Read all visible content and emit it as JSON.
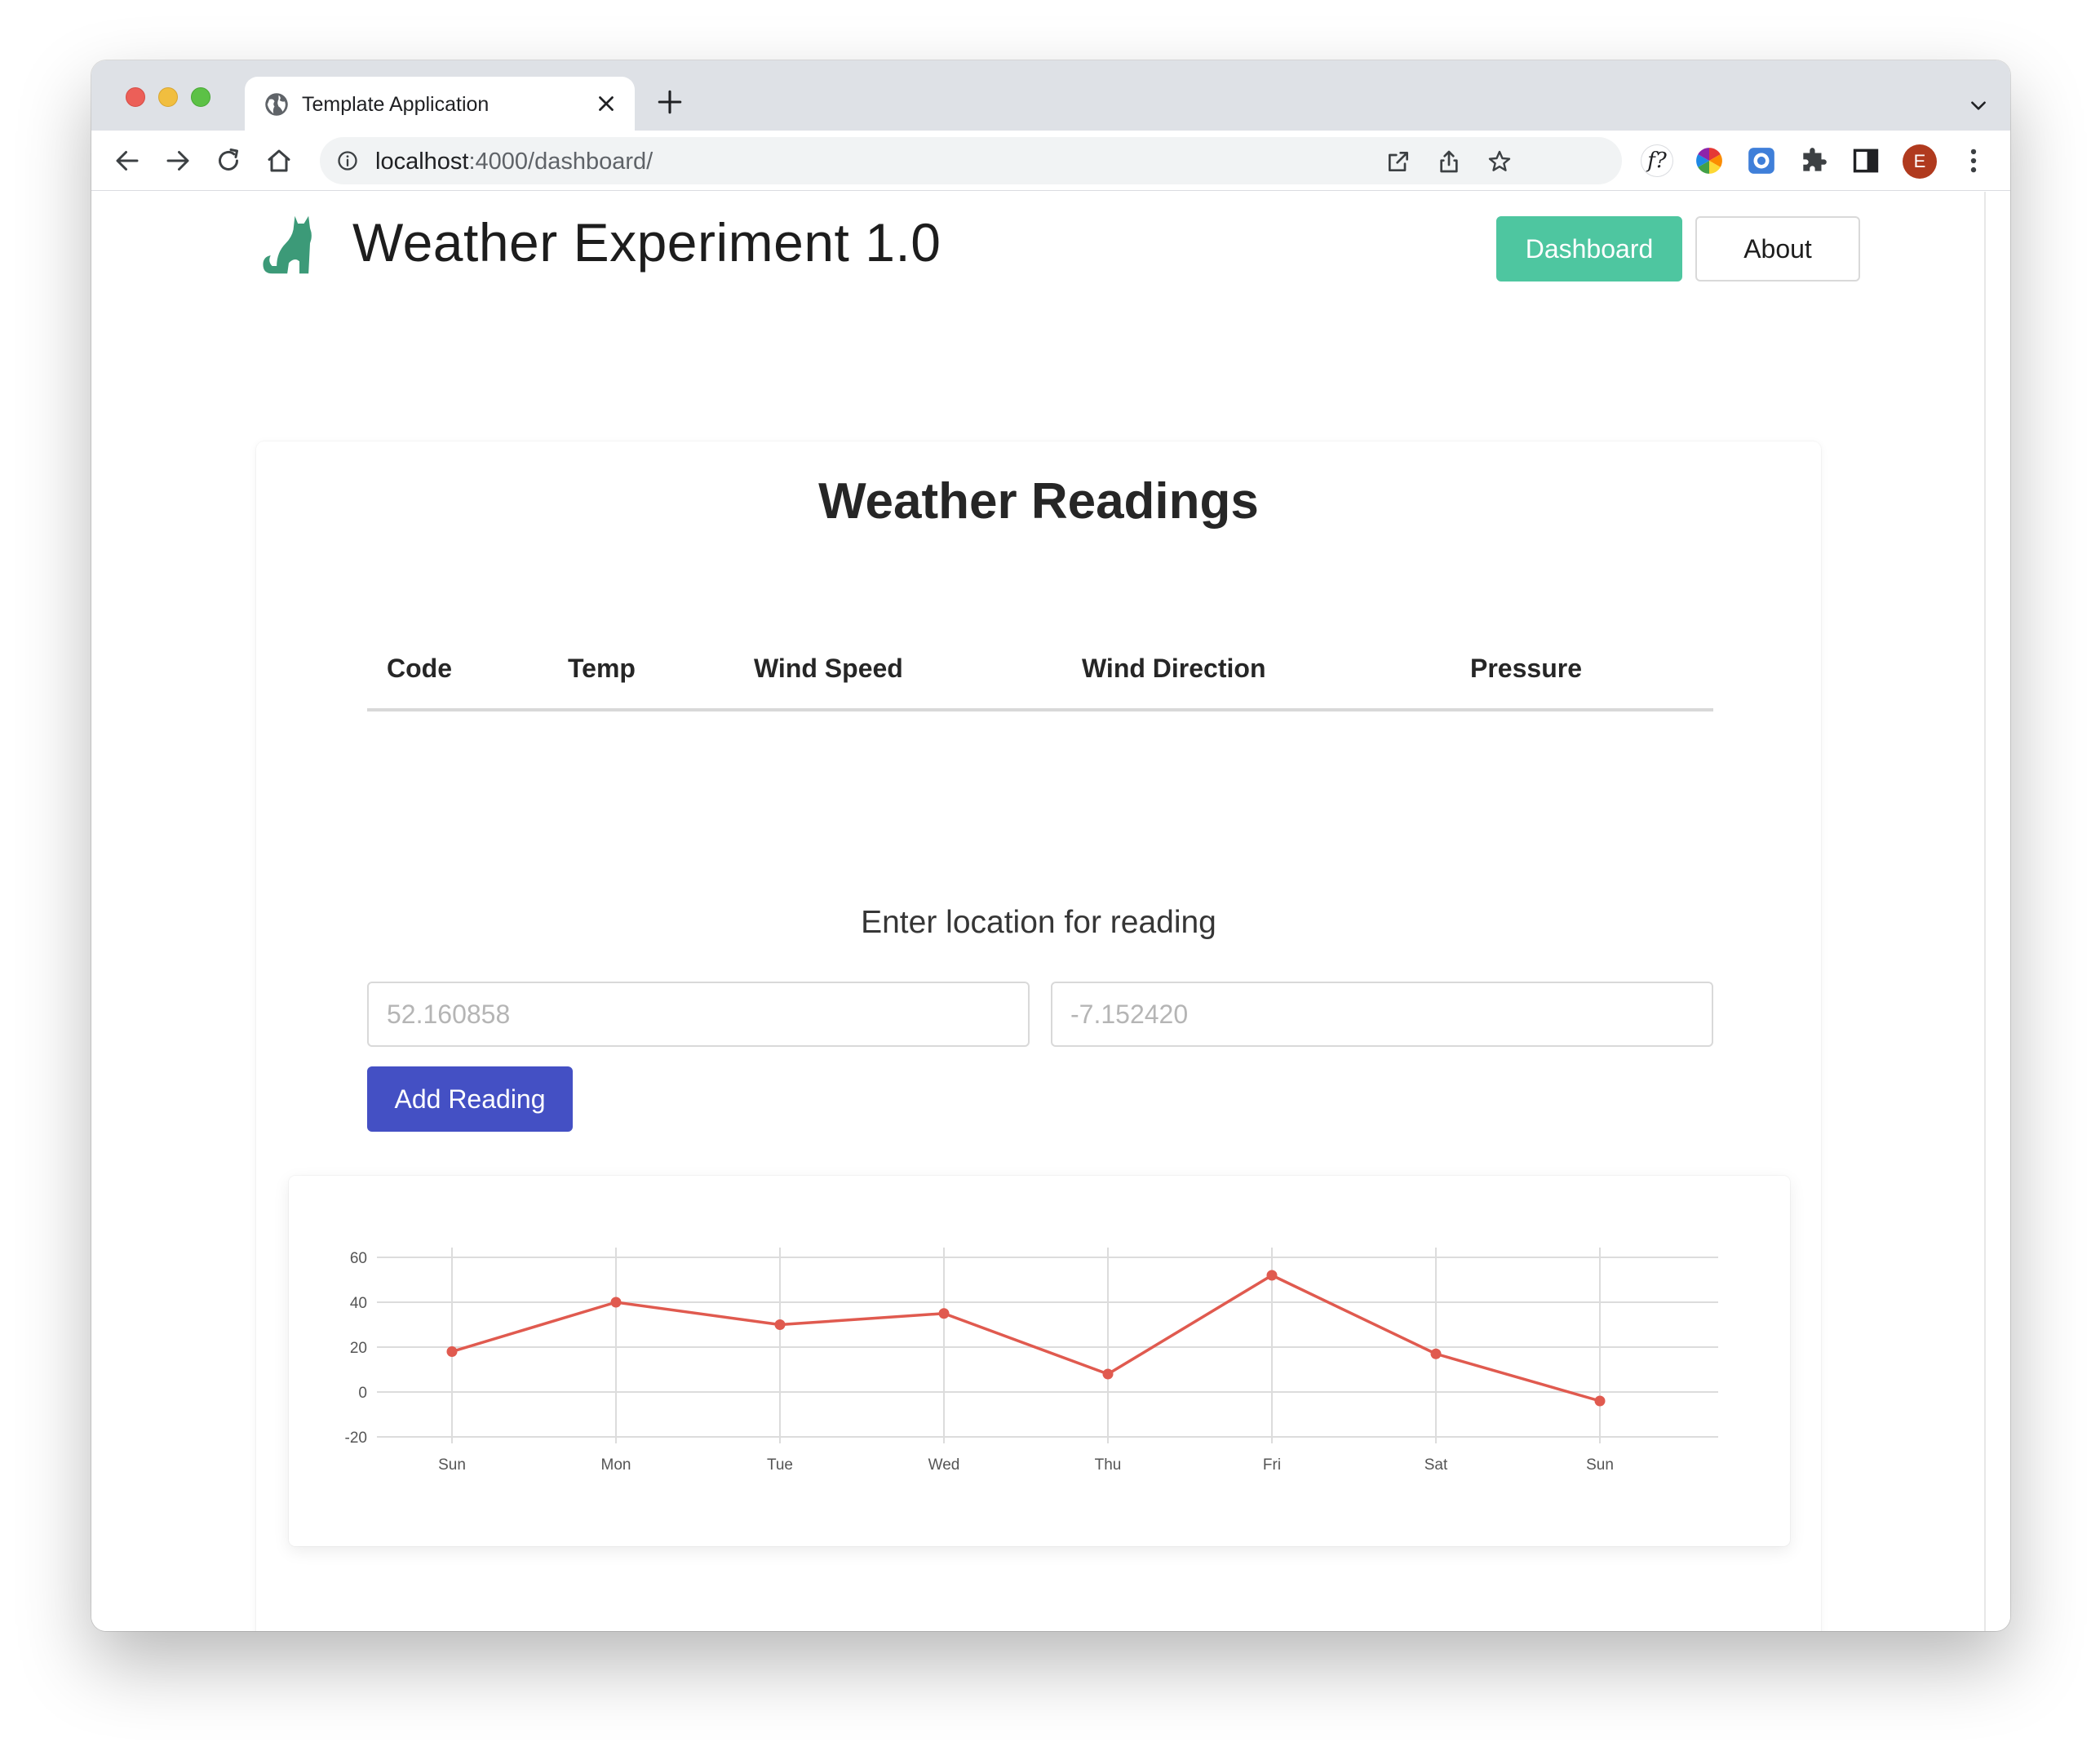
{
  "browser": {
    "tab_title": "Template Application",
    "url_host": "localhost",
    "url_path": ":4000/dashboard/",
    "profile_initial": "E",
    "extension_text": "f?"
  },
  "header": {
    "title": "Weather Experiment 1.0",
    "logo_icon": "cat-icon",
    "brand_color": "#3c9a78",
    "nav": {
      "dashboard_label": "Dashboard",
      "about_label": "About"
    }
  },
  "main": {
    "title": "Weather Readings",
    "table": {
      "columns": [
        "Code",
        "Temp",
        "Wind Speed",
        "Wind Direction",
        "Pressure"
      ],
      "rows": []
    },
    "location_label": "Enter location for reading",
    "latitude_placeholder": "52.160858",
    "longitude_placeholder": "-7.152420",
    "add_button_label": "Add Reading",
    "accent_color": "#4450c4",
    "nav_active_color": "#4ec6a0"
  },
  "chart_data": {
    "type": "line",
    "categories": [
      "Sun",
      "Mon",
      "Tue",
      "Wed",
      "Thu",
      "Fri",
      "Sat",
      "Sun"
    ],
    "series": [
      {
        "values": [
          18,
          40,
          30,
          35,
          8,
          52,
          17,
          -4
        ],
        "color": "#e05a4f"
      }
    ],
    "title": "",
    "xlabel": "",
    "ylabel": "",
    "ylim": [
      -20,
      60
    ],
    "yticks": [
      60,
      40,
      20,
      0,
      -20
    ],
    "grid": true
  }
}
